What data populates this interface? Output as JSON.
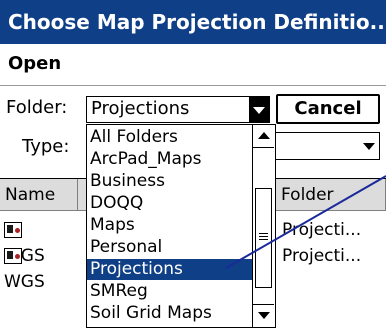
{
  "window": {
    "title": "Choose Map Projection Definitio..."
  },
  "menu": {
    "open_label": "Open"
  },
  "folder": {
    "label": "Folder:",
    "value": "Projections"
  },
  "cancel_label": "Cancel",
  "type": {
    "label": "Type:"
  },
  "columns": {
    "name": "Name",
    "folder": "Folder"
  },
  "rows": [
    {
      "name": "WGS",
      "folder": "Projecti..."
    },
    {
      "name": "WGS",
      "folder": "Projecti..."
    }
  ],
  "dropdown": {
    "items": [
      "All Folders",
      "ArcPad_Maps",
      "Business",
      "DOQQ",
      "Maps",
      "Personal",
      "Projections",
      "SMReg",
      "Soil Grid Maps"
    ],
    "selected": "Projections"
  },
  "colors": {
    "titlebar": "#0f3f86",
    "selection": "#0f3f86",
    "pointer_line": "#1a2a9a"
  }
}
